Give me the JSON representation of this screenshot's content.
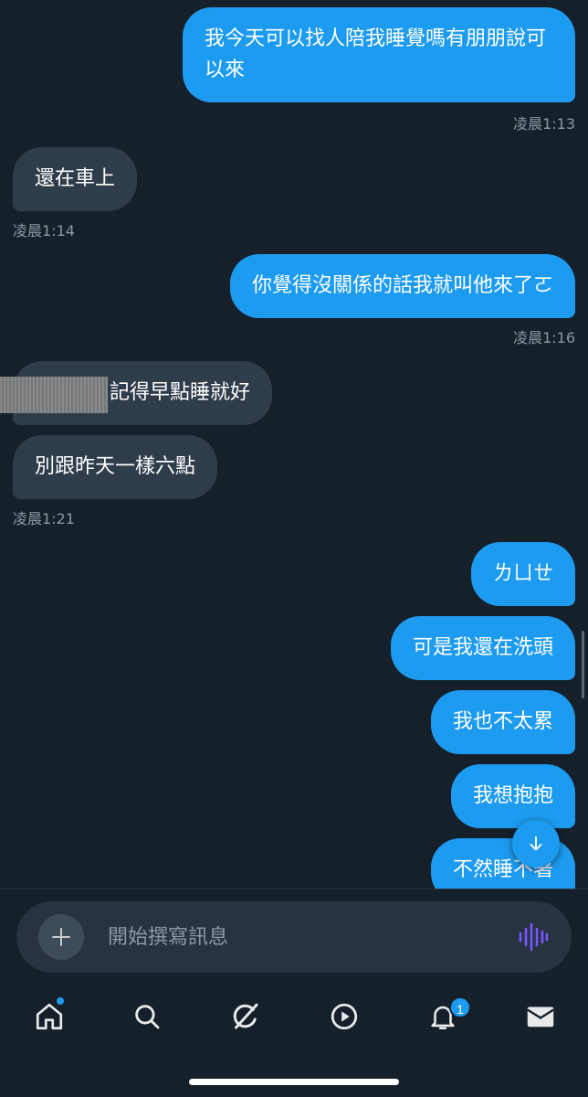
{
  "messages": [
    {
      "dir": "out",
      "text": "我今天可以找人陪我睡覺嗎有朋朋說可以來"
    },
    {
      "dir": "in",
      "text": "還在車上"
    },
    {
      "dir": "out",
      "text": "你覺得沒關係的話我就叫他來了ㄛ"
    },
    {
      "dir": "in",
      "text": "記得早點睡就好"
    },
    {
      "dir": "in",
      "text": "別跟昨天一樣六點"
    },
    {
      "dir": "out",
      "text": "ㄌㄩㄝ"
    },
    {
      "dir": "out",
      "text": "可是我還在洗頭"
    },
    {
      "dir": "out",
      "text": "我也不太累"
    },
    {
      "dir": "out",
      "text": "我想抱抱"
    },
    {
      "dir": "out",
      "text": "不然睡不著"
    }
  ],
  "timestamps": [
    "凌晨1:13",
    "凌晨1:14",
    "凌晨1:16",
    "凌晨1:21"
  ],
  "composer": {
    "placeholder": "開始撰寫訊息"
  },
  "tabs": [
    {
      "name": "home",
      "icon": "home-icon",
      "has_dot": true
    },
    {
      "name": "search",
      "icon": "search-icon"
    },
    {
      "name": "grok",
      "icon": "slash-circle-icon"
    },
    {
      "name": "video",
      "icon": "play-icon"
    },
    {
      "name": "notifications",
      "icon": "bell-icon",
      "badge": "1"
    },
    {
      "name": "messages",
      "icon": "envelope-icon"
    }
  ],
  "colors": {
    "background": "#15202b",
    "outgoing": "#1d9bf0",
    "incoming": "#2f3c4a",
    "timestamp": "#8b98a5",
    "voice": "#7856ff"
  }
}
